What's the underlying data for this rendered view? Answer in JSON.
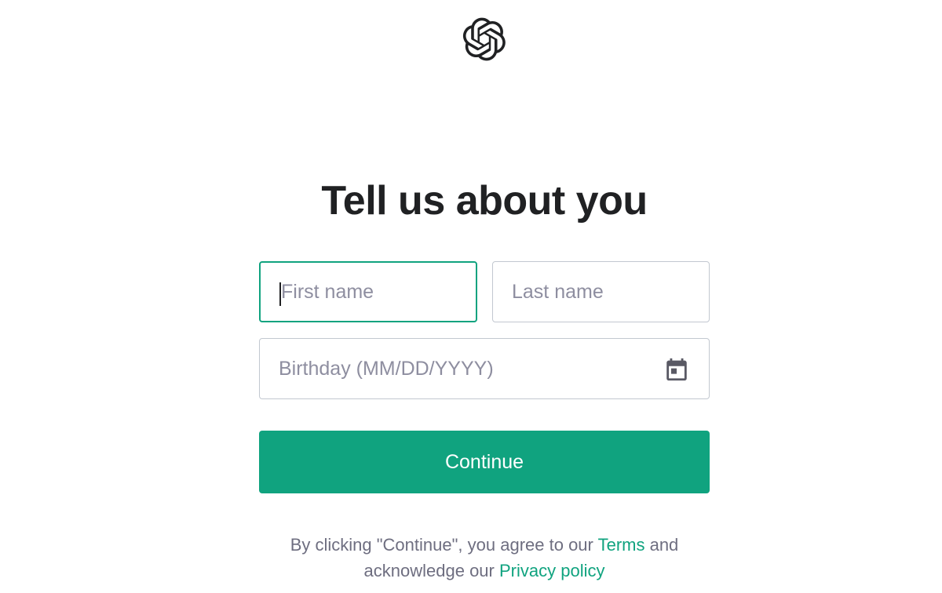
{
  "logo": {
    "icon": "openai-logo-icon"
  },
  "heading": {
    "title": "Tell us about you"
  },
  "form": {
    "first_name": {
      "placeholder": "First name",
      "value": ""
    },
    "last_name": {
      "placeholder": "Last name",
      "value": ""
    },
    "birthday": {
      "placeholder": "Birthday (MM/DD/YYYY)",
      "value": "",
      "icon": "calendar-icon"
    },
    "continue_label": "Continue"
  },
  "legal": {
    "line1_prefix": "By clicking \"Continue\", you agree to our ",
    "terms_link": "Terms",
    "line1_suffix": " and",
    "line2_prefix": "acknowledge our ",
    "privacy_link": "Privacy policy"
  },
  "colors": {
    "accent": "#10a37f",
    "title": "#202123",
    "muted_text": "#6e6e80",
    "placeholder": "#8e8ea0",
    "border": "#c2c8d0"
  }
}
